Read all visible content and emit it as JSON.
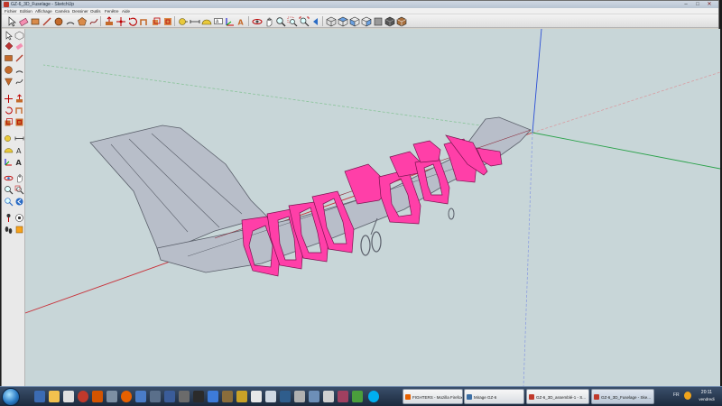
{
  "window": {
    "title": "GZ-6_3D_Fuselage - SketchUp",
    "controls": {
      "minimize": "–",
      "maximize": "□",
      "close": "✕"
    }
  },
  "menubar": {
    "items": [
      "Fichier",
      "Edition",
      "Affichage",
      "Caméra",
      "Dessiner",
      "Outils",
      "Fenêtre",
      "Aide"
    ]
  },
  "toolbar": {
    "icons": [
      "select-icon",
      "eraser-icon",
      "rectangle-icon",
      "line-icon",
      "circle-icon",
      "arc-icon",
      "polygon-icon",
      "freehand-icon",
      "push-pull-icon",
      "move-icon",
      "rotate-icon",
      "follow-me-icon",
      "scale-icon",
      "offset-icon",
      "tape-measure-icon",
      "dimension-icon",
      "protractor-icon",
      "text-icon",
      "axes-icon",
      "3d-text-icon",
      "orbit-icon",
      "pan-icon",
      "zoom-icon",
      "zoom-window-icon",
      "zoom-extents-icon",
      "previous-view-icon",
      "next-view-icon",
      "camera-position-icon",
      "walk-icon",
      "look-around-icon",
      "section-plane-icon",
      "iso-view-icon",
      "top-view-icon",
      "front-view-icon",
      "right-view-icon",
      "back-view-icon",
      "left-view-icon",
      "xray-icon",
      "wireframe-icon",
      "hidden-line-icon",
      "shaded-icon",
      "shaded-textures-icon",
      "monochrome-icon"
    ]
  },
  "viewport": {
    "background": "#c8d6d8",
    "colors": {
      "bulkhead": "#ff3fa8",
      "skin": "#b8bec9",
      "axis_red": "#c8323a",
      "axis_green": "#2aa24a",
      "axis_blue": "#2c4fd6"
    }
  },
  "taskbar": {
    "tasks": [
      {
        "label": "FIGHTERS - Mozilla Firefox",
        "color": "#e66000"
      },
      {
        "label": "Mirage GZ-6",
        "color": "#3a6ea5"
      },
      {
        "label": "GZ-6_3D_assemblé-1 - S...",
        "color": "#c0392b"
      },
      {
        "label": "GZ-6_3D_Fuselage - Ske...",
        "color": "#c0392b"
      }
    ],
    "language": "FR",
    "clock": {
      "time": "20:11",
      "day": "vendredi"
    }
  }
}
